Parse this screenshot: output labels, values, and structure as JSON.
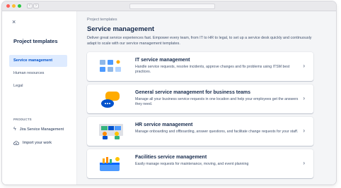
{
  "browser": {
    "back_glyph": "‹",
    "forward_glyph": "›",
    "traffic_light_colors": [
      "#fe5f57",
      "#febc2e",
      "#28c840"
    ]
  },
  "sidebar": {
    "close_glyph": "×",
    "title": "Project templates",
    "items": [
      {
        "label": "Service management",
        "active": true
      },
      {
        "label": "Human resources",
        "active": false
      },
      {
        "label": "Legal",
        "active": false
      }
    ],
    "products_heading": "PRODUCTS",
    "product": {
      "label": "Jira Service Management",
      "icon": "bolt-icon"
    },
    "import": {
      "label": "Import your work",
      "icon": "cloud-upload-icon"
    }
  },
  "main": {
    "breadcrumb": "Project templates",
    "title": "Service management",
    "intro": "Deliver great service experiences fast. Empower every team, from IT to HR to legal, to set up a service desk quickly and continuously adapt to scale with our service management templates.",
    "cards": [
      {
        "title": "IT service management",
        "description": "Handle service requests, resolve incidents, approve changes and fix problems using ITSM best practices.",
        "illustration": "it-service-illustration"
      },
      {
        "title": "General service management for business teams",
        "description": "Manage all your business service requests in one location and help your employees get the answers they need.",
        "illustration": "chat-bubbles-illustration"
      },
      {
        "title": "HR service management",
        "description": "Manage onboarding and offboarding, answer questions, and facilitate change requests for your staff.",
        "illustration": "hr-people-illustration"
      },
      {
        "title": "Facilities service management",
        "description": "Easily manage requests for maintenance, moving, and event planning",
        "illustration": "facilities-toolbox-illustration"
      }
    ],
    "chevron_glyph": "›"
  },
  "colors": {
    "active_bg": "#deebff",
    "active_text": "#0052cc",
    "main_bg": "#f4f5f7"
  }
}
